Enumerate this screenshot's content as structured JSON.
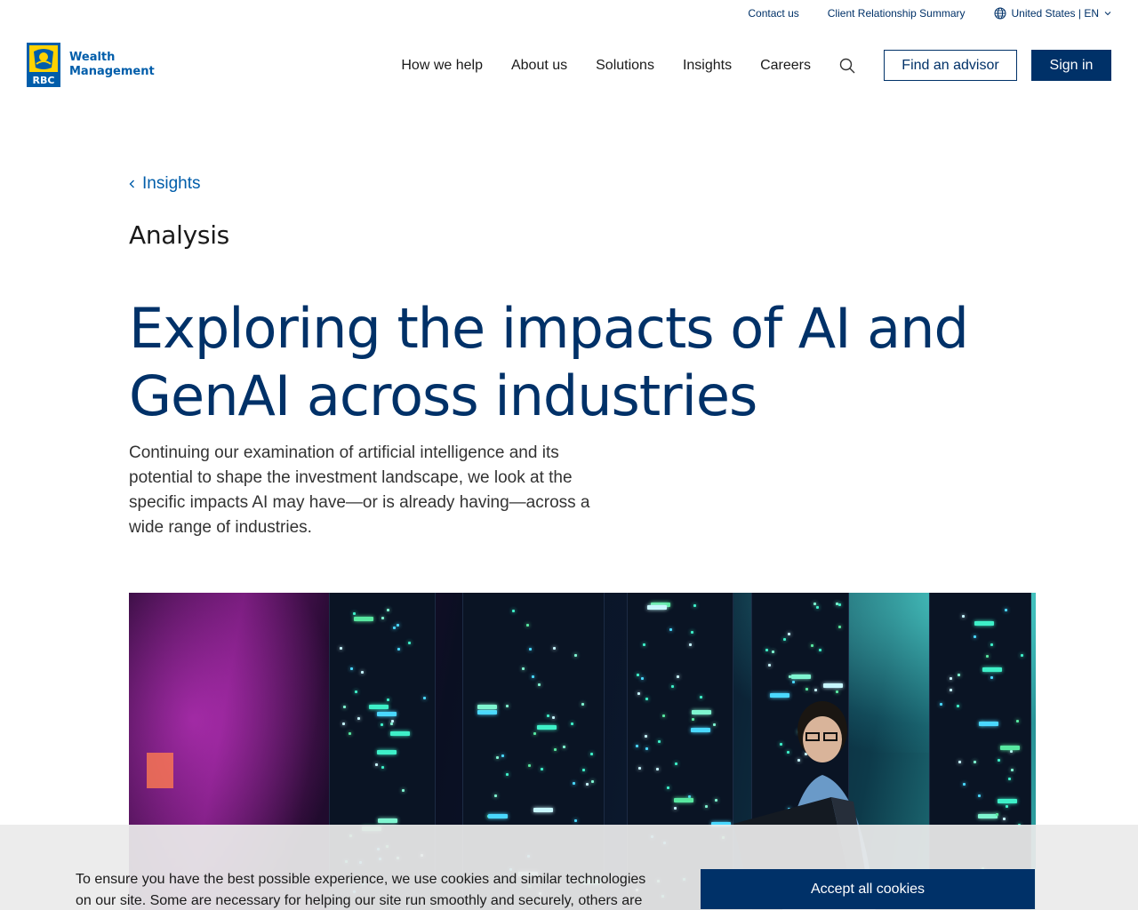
{
  "utility": {
    "contact": "Contact us",
    "crs": "Client Relationship Summary",
    "region": "United States | EN"
  },
  "brand": {
    "logo_text": "RBC",
    "line1": "Wealth",
    "line2": "Management"
  },
  "nav": {
    "items": [
      {
        "label": "How we help"
      },
      {
        "label": "About us"
      },
      {
        "label": "Solutions"
      },
      {
        "label": "Insights"
      },
      {
        "label": "Careers"
      }
    ],
    "find_advisor": "Find an advisor",
    "sign_in": "Sign in"
  },
  "article": {
    "breadcrumb": "Insights",
    "eyebrow": "Analysis",
    "title": "Exploring the impacts of AI and GenAI across industries",
    "subtitle": "Continuing our examination of artificial intelligence and its potential to shape the investment landscape, we look at the specific impacts AI may have—or is already having—across a wide range of industries."
  },
  "cookie": {
    "text": "To ensure you have the best possible experience, we use cookies and similar technologies on our site. Some are necessary for helping our site run smoothly and securely, others are",
    "accept": "Accept all cookies"
  },
  "colors": {
    "brand_navy": "#003168",
    "brand_blue": "#005daa",
    "brand_yellow": "#ffd200"
  }
}
